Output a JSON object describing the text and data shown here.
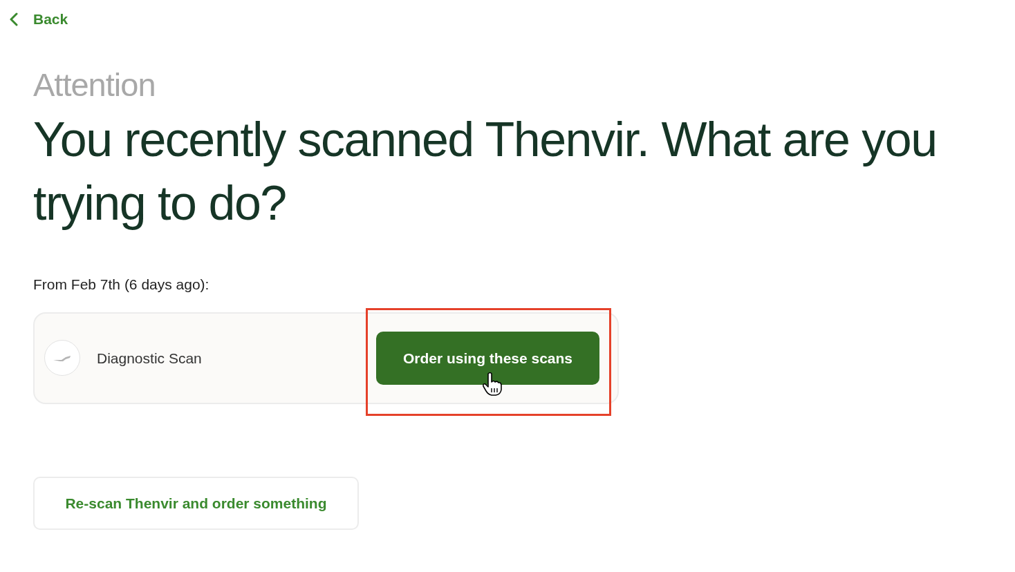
{
  "back": {
    "label": "Back"
  },
  "eyebrow": "Attention",
  "headline": "You recently scanned Thenvir. What are you trying to do?",
  "scan_group": {
    "label": "From Feb 7th (6 days ago):",
    "scans": [
      {
        "name": "Diagnostic Scan",
        "action": "Order using these scans",
        "highlighted": true
      }
    ]
  },
  "secondary_action": "Re-scan Thenvir and order something"
}
